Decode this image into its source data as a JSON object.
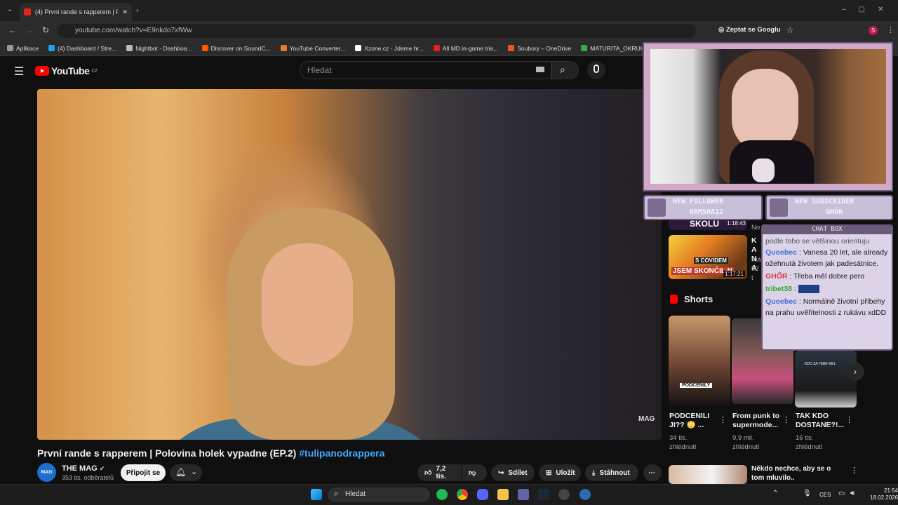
{
  "browser": {
    "tab_title": "(4) První rande s rapperem | Po",
    "url": "youtube.com/watch?v=E9nkdo7xfWw",
    "ask_google": "Zeptat se Googlu",
    "bookmarks": [
      "Aplikace",
      "(4) Dashboard / Stre...",
      "Nightbot - Dashboa...",
      "Discover on SoundC...",
      "YouTube Converter...",
      "Xzone.cz - Jdeme hr...",
      "All MD in-game tria...",
      "Soubory – OneDrive",
      "MATURITA_OKRUH..."
    ],
    "bookmark_colors": [
      "#999999",
      "#1da1f2",
      "#bbbbbb",
      "#ff5500",
      "#e67e22",
      "#ffffff",
      "#e62117",
      "#f35325",
      "#34a853"
    ]
  },
  "youtube": {
    "logo_text": "YouTube",
    "region": "CZ",
    "search_placeholder": "Hledat",
    "video_watermark": "MAG",
    "video_title": "První rande s rapperem | Polovina holek vypadne (EP.2)",
    "video_hashtag": "#tulipanodrappera",
    "channel_name": "THE MAG",
    "channel_avatar_text": "MAG",
    "channel_subs": "353 tis. odběratelů",
    "subscribe_label": "Připojit se",
    "likes": "7,2 tis.",
    "share_label": "Sdílet",
    "save_label": "Uložit",
    "download_label": "Stáhnout"
  },
  "sidebar": {
    "partial_top_text": "SKOLU",
    "partial_top_duration": "1:18:43",
    "partial_top_meta": "No",
    "rec_thumb_text": "JSEM SKONČIL N",
    "rec_thumb_text2": "S COVIDEM",
    "rec_duration": "1:17:21",
    "rec_title_partial": "KA NA",
    "rec_meta_partial": "Viá 92 t",
    "shorts_heading": "Shorts",
    "shorts": [
      {
        "title": "PODCENILI JI?? 😳 ...",
        "views": "34 tis. zhlédnutí",
        "overlay": "PODCENILY"
      },
      {
        "title": "From punk to supermode...",
        "views": "9,9 mil. zhlédnutí",
        "overlay": ""
      },
      {
        "title": "TAK KDO DOSTANE?!...",
        "views": "16 tis. zhlédnutí",
        "overlay": "KDO ZA TEBE MEL"
      }
    ],
    "next_title": "Někdo nechce, aby se o tom mluvilo.."
  },
  "stream_overlay": {
    "follower_label": "NEW FOLLOWER",
    "follower_name": "HAMSHA12",
    "subscriber_label": "NEW SUBSCRIBER",
    "subscriber_name": "GHŐR",
    "chat_title": "CHAT BOX",
    "chat_partial": "podle toho se většinou orientuju",
    "messages": [
      {
        "user": "Quoebec",
        "text": "Vanesa 20 let, ale already ožehnutá životem jak padesátnice.",
        "color": "#3b6fd8"
      },
      {
        "user": "GHŐR",
        "text": "Třeba měl dobre pero",
        "color": "#d83b3b"
      },
      {
        "user": "tribet38",
        "text": "",
        "color": "#2ea82e"
      },
      {
        "user": "Quoebec",
        "text": "Normálně životní příbehy na prahu uvěřitelnosti z rukávu xdDD",
        "color": "#3b6fd8"
      }
    ]
  },
  "taskbar": {
    "search_label": "Hledat",
    "lang": "CES",
    "time": "21:54",
    "date": "18.02.2026"
  }
}
